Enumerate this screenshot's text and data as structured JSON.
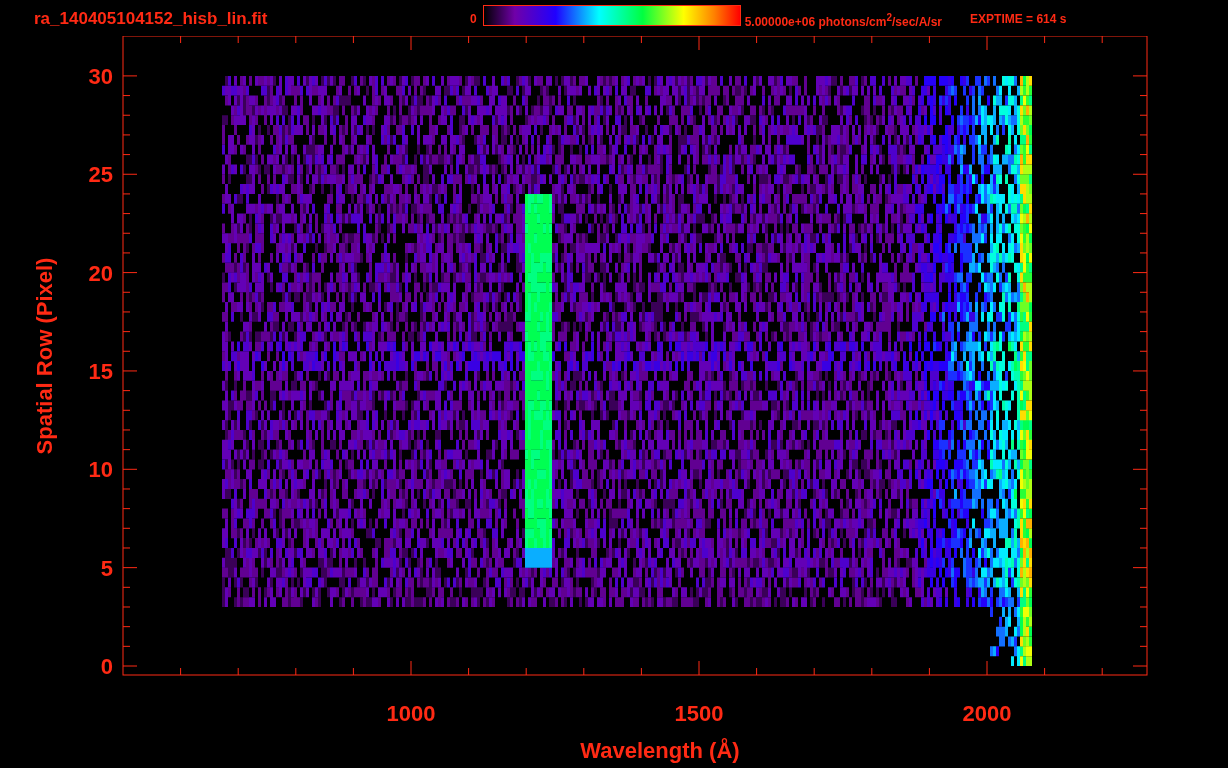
{
  "header": {
    "filename": "ra_140405104152_hisb_lin.fit",
    "colorbar": {
      "min_label": "0",
      "max_label": "5.00000e+06 photons/cm$^{2}$/sec/A/sr"
    },
    "exposure": "EXPTIME = 614 s"
  },
  "plot": {
    "x_axis": {
      "title": "Wavelength (Å)",
      "tick_labels": [
        "1000",
        "1500",
        "2000"
      ]
    },
    "y_axis": {
      "title": "Spatial Row (Pixel)",
      "tick_labels": [
        "30",
        "25",
        "20",
        "15",
        "10",
        "5",
        "0"
      ]
    }
  }
}
